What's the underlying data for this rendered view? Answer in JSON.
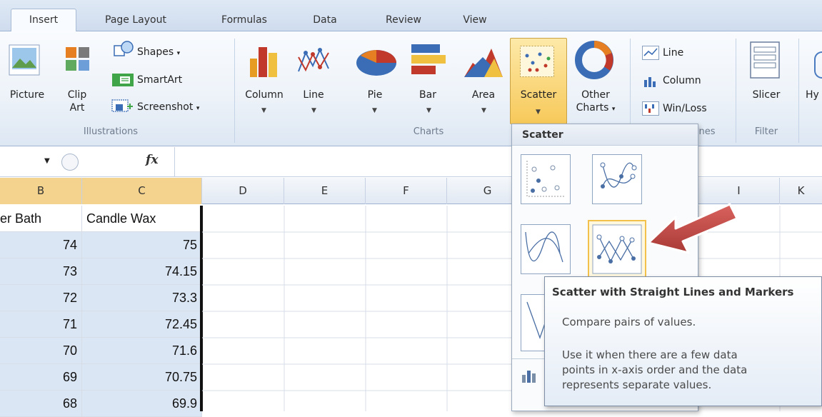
{
  "tabs": [
    {
      "label": "Insert",
      "active": true
    },
    {
      "label": "Page Layout"
    },
    {
      "label": "Formulas"
    },
    {
      "label": "Data"
    },
    {
      "label": "Review"
    },
    {
      "label": "View"
    }
  ],
  "ribbon": {
    "illustrations": {
      "group_label": "Illustrations",
      "picture": "Picture",
      "clip_art_line1": "Clip",
      "clip_art_line2": "Art",
      "shapes": "Shapes",
      "smartart": "SmartArt",
      "screenshot": "Screenshot"
    },
    "charts": {
      "group_label": "Charts",
      "column": "Column",
      "line": "Line",
      "pie": "Pie",
      "bar": "Bar",
      "area": "Area",
      "scatter": "Scatter",
      "other_line1": "Other",
      "other_line2": "Charts"
    },
    "sparklines": {
      "group_label_partial": "nes",
      "line": "Line",
      "column": "Column",
      "winloss": "Win/Loss"
    },
    "filter": {
      "group_label": "Filter",
      "slicer": "Slicer"
    },
    "links_partial": "Hy"
  },
  "formula_bar": {
    "fx": "fx",
    "value": ""
  },
  "columns": [
    "B",
    "C",
    "D",
    "E",
    "F",
    "G",
    "I",
    "K"
  ],
  "sheet": {
    "header_b": "er Bath",
    "header_c": "Candle Wax",
    "rows": [
      {
        "b": "74",
        "c": "75"
      },
      {
        "b": "73",
        "c": "74.15"
      },
      {
        "b": "72",
        "c": "73.3"
      },
      {
        "b": "71",
        "c": "72.45"
      },
      {
        "b": "70",
        "c": "71.6"
      },
      {
        "b": "69",
        "c": "70.75"
      },
      {
        "b": "68",
        "c": "69.9"
      }
    ]
  },
  "dropdown": {
    "title": "Scatter"
  },
  "tooltip": {
    "title": "Scatter with Straight Lines and Markers",
    "line1": "Compare pairs of values.",
    "line2": "Use it when there are a few data",
    "line3": "points in x-axis order and the data",
    "line4": "represents separate values."
  },
  "colors": {
    "accent_arrow": "#c0504d",
    "hover": "#f2c14b",
    "selection": "#dbe6f4"
  }
}
